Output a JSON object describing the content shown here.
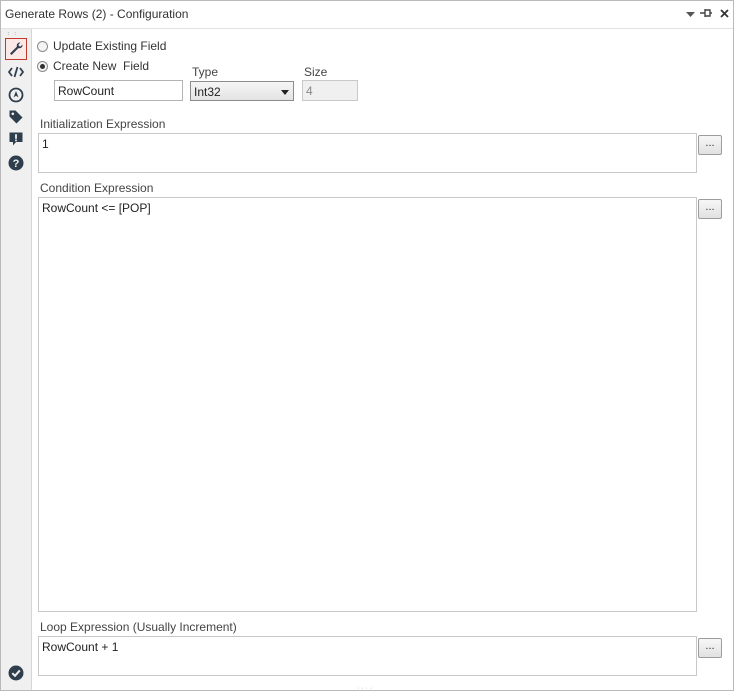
{
  "window": {
    "title": "Generate Rows (2) - Configuration",
    "controls": {
      "dropdown_icon": "chevron-down-icon",
      "pin_icon": "pin-icon",
      "close_icon": "close-icon"
    }
  },
  "sidebar": {
    "items": [
      {
        "name": "configuration",
        "icon": "wrench-icon",
        "active": true
      },
      {
        "name": "xml",
        "icon": "code-icon",
        "active": false
      },
      {
        "name": "annotation",
        "icon": "compass-icon",
        "active": false
      },
      {
        "name": "tags",
        "icon": "tag-icon",
        "active": false
      },
      {
        "name": "messages",
        "icon": "alert-icon",
        "active": false
      },
      {
        "name": "help",
        "icon": "help-icon",
        "active": false
      }
    ],
    "bottom_icon": "check-circle-icon"
  },
  "form": {
    "update_existing_label": "Update Existing Field",
    "create_new_label": "Create New  Field",
    "selected_mode": "create_new",
    "type_label": "Type",
    "size_label": "Size",
    "field_name_value": "RowCount",
    "type_value": "Int32",
    "size_value": "4",
    "init_label": "Initialization Expression",
    "init_value": "1",
    "condition_label": "Condition Expression",
    "condition_value": "RowCount <= [POP]",
    "loop_label": "Loop Expression (Usually Increment)",
    "loop_value": "RowCount + 1",
    "ellipsis_label": "..."
  },
  "colors": {
    "accent": "#c0392b",
    "sidebar_icon": "#2f3e4d",
    "check": "#2f3e4d"
  }
}
